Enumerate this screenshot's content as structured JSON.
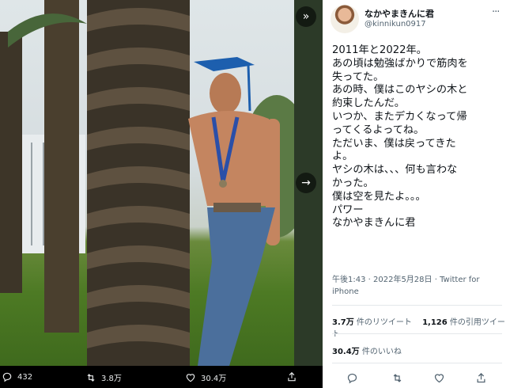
{
  "media": {
    "collapse_icon": "double-chevron-right-icon",
    "next_icon": "arrow-right-icon",
    "actions": {
      "reply_count": "432",
      "retweet_count": "3.8万",
      "like_count": "30.4万"
    }
  },
  "tweet": {
    "display_name": "なかやまきんに君",
    "handle": "@kinnikun0917",
    "text_lines": [
      "2011年と2022年。",
      "あの頃は勉強ばかりで筋肉を",
      "失ってた。",
      "あの時、僕はこのヤシの木と",
      "約束したんだ。",
      "いつか、またデカくなって帰",
      "ってくるよってね。",
      "ただいま、僕は戻ってきた",
      "よ。",
      "ヤシの木は、、、何も言わな",
      "かった。",
      "僕は空を見たよ。。。",
      "パワー",
      "なかやまきんに君"
    ],
    "timestamp": "午後1:43 · 2022年5月28日 · ",
    "source_line1": "Twitter for",
    "source_line2": "iPhone",
    "retweets_value": "3.7万",
    "retweets_label": " 件のリツイート",
    "quotes_value": "1,126",
    "quotes_label": " 件の引用ツイート",
    "likes_value": "30.4万",
    "likes_label": " 件のいいね"
  },
  "colors": {
    "text_primary": "#0f1419",
    "text_secondary": "#536471",
    "divider": "#e4e8eb"
  }
}
